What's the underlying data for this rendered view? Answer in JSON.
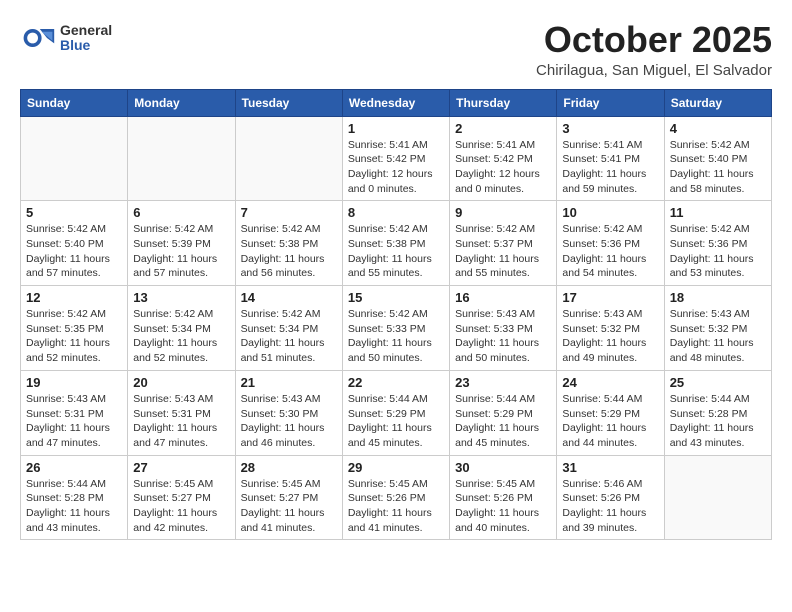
{
  "header": {
    "logo_general": "General",
    "logo_blue": "Blue",
    "month_title": "October 2025",
    "subtitle": "Chirilagua, San Miguel, El Salvador"
  },
  "weekdays": [
    "Sunday",
    "Monday",
    "Tuesday",
    "Wednesday",
    "Thursday",
    "Friday",
    "Saturday"
  ],
  "weeks": [
    [
      {
        "day": "",
        "info": ""
      },
      {
        "day": "",
        "info": ""
      },
      {
        "day": "",
        "info": ""
      },
      {
        "day": "1",
        "info": "Sunrise: 5:41 AM\nSunset: 5:42 PM\nDaylight: 12 hours\nand 0 minutes."
      },
      {
        "day": "2",
        "info": "Sunrise: 5:41 AM\nSunset: 5:42 PM\nDaylight: 12 hours\nand 0 minutes."
      },
      {
        "day": "3",
        "info": "Sunrise: 5:41 AM\nSunset: 5:41 PM\nDaylight: 11 hours\nand 59 minutes."
      },
      {
        "day": "4",
        "info": "Sunrise: 5:42 AM\nSunset: 5:40 PM\nDaylight: 11 hours\nand 58 minutes."
      }
    ],
    [
      {
        "day": "5",
        "info": "Sunrise: 5:42 AM\nSunset: 5:40 PM\nDaylight: 11 hours\nand 57 minutes."
      },
      {
        "day": "6",
        "info": "Sunrise: 5:42 AM\nSunset: 5:39 PM\nDaylight: 11 hours\nand 57 minutes."
      },
      {
        "day": "7",
        "info": "Sunrise: 5:42 AM\nSunset: 5:38 PM\nDaylight: 11 hours\nand 56 minutes."
      },
      {
        "day": "8",
        "info": "Sunrise: 5:42 AM\nSunset: 5:38 PM\nDaylight: 11 hours\nand 55 minutes."
      },
      {
        "day": "9",
        "info": "Sunrise: 5:42 AM\nSunset: 5:37 PM\nDaylight: 11 hours\nand 55 minutes."
      },
      {
        "day": "10",
        "info": "Sunrise: 5:42 AM\nSunset: 5:36 PM\nDaylight: 11 hours\nand 54 minutes."
      },
      {
        "day": "11",
        "info": "Sunrise: 5:42 AM\nSunset: 5:36 PM\nDaylight: 11 hours\nand 53 minutes."
      }
    ],
    [
      {
        "day": "12",
        "info": "Sunrise: 5:42 AM\nSunset: 5:35 PM\nDaylight: 11 hours\nand 52 minutes."
      },
      {
        "day": "13",
        "info": "Sunrise: 5:42 AM\nSunset: 5:34 PM\nDaylight: 11 hours\nand 52 minutes."
      },
      {
        "day": "14",
        "info": "Sunrise: 5:42 AM\nSunset: 5:34 PM\nDaylight: 11 hours\nand 51 minutes."
      },
      {
        "day": "15",
        "info": "Sunrise: 5:42 AM\nSunset: 5:33 PM\nDaylight: 11 hours\nand 50 minutes."
      },
      {
        "day": "16",
        "info": "Sunrise: 5:43 AM\nSunset: 5:33 PM\nDaylight: 11 hours\nand 50 minutes."
      },
      {
        "day": "17",
        "info": "Sunrise: 5:43 AM\nSunset: 5:32 PM\nDaylight: 11 hours\nand 49 minutes."
      },
      {
        "day": "18",
        "info": "Sunrise: 5:43 AM\nSunset: 5:32 PM\nDaylight: 11 hours\nand 48 minutes."
      }
    ],
    [
      {
        "day": "19",
        "info": "Sunrise: 5:43 AM\nSunset: 5:31 PM\nDaylight: 11 hours\nand 47 minutes."
      },
      {
        "day": "20",
        "info": "Sunrise: 5:43 AM\nSunset: 5:31 PM\nDaylight: 11 hours\nand 47 minutes."
      },
      {
        "day": "21",
        "info": "Sunrise: 5:43 AM\nSunset: 5:30 PM\nDaylight: 11 hours\nand 46 minutes."
      },
      {
        "day": "22",
        "info": "Sunrise: 5:44 AM\nSunset: 5:29 PM\nDaylight: 11 hours\nand 45 minutes."
      },
      {
        "day": "23",
        "info": "Sunrise: 5:44 AM\nSunset: 5:29 PM\nDaylight: 11 hours\nand 45 minutes."
      },
      {
        "day": "24",
        "info": "Sunrise: 5:44 AM\nSunset: 5:29 PM\nDaylight: 11 hours\nand 44 minutes."
      },
      {
        "day": "25",
        "info": "Sunrise: 5:44 AM\nSunset: 5:28 PM\nDaylight: 11 hours\nand 43 minutes."
      }
    ],
    [
      {
        "day": "26",
        "info": "Sunrise: 5:44 AM\nSunset: 5:28 PM\nDaylight: 11 hours\nand 43 minutes."
      },
      {
        "day": "27",
        "info": "Sunrise: 5:45 AM\nSunset: 5:27 PM\nDaylight: 11 hours\nand 42 minutes."
      },
      {
        "day": "28",
        "info": "Sunrise: 5:45 AM\nSunset: 5:27 PM\nDaylight: 11 hours\nand 41 minutes."
      },
      {
        "day": "29",
        "info": "Sunrise: 5:45 AM\nSunset: 5:26 PM\nDaylight: 11 hours\nand 41 minutes."
      },
      {
        "day": "30",
        "info": "Sunrise: 5:45 AM\nSunset: 5:26 PM\nDaylight: 11 hours\nand 40 minutes."
      },
      {
        "day": "31",
        "info": "Sunrise: 5:46 AM\nSunset: 5:26 PM\nDaylight: 11 hours\nand 39 minutes."
      },
      {
        "day": "",
        "info": ""
      }
    ]
  ]
}
